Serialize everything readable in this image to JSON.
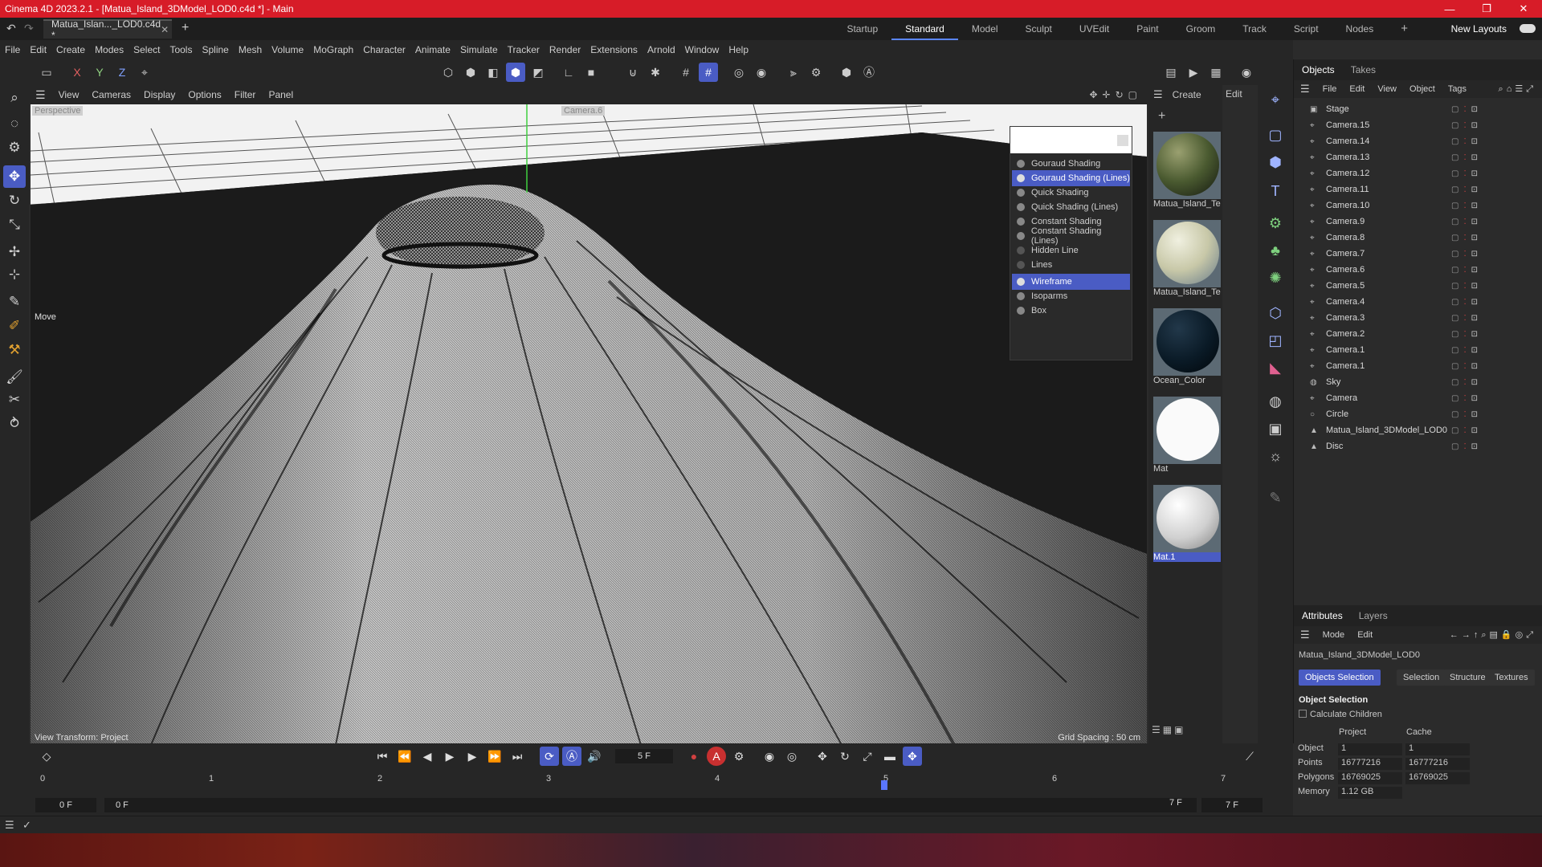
{
  "app": {
    "title": "Cinema 4D 2023.2.1 - [Matua_Island_3DModel_LOD0.c4d *] - Main",
    "document_tab": "Matua_Islan..._LOD0.c4d *",
    "accent_color": "#4a5cc4",
    "titlebar_color": "#d71c28"
  },
  "layouts": {
    "items": [
      "Startup",
      "Standard",
      "Model",
      "Sculpt",
      "UVEdit",
      "Paint",
      "Groom",
      "Track",
      "Script",
      "Nodes"
    ],
    "active": "Standard",
    "new_layouts": "New Layouts"
  },
  "menubar": [
    "File",
    "Edit",
    "Create",
    "Modes",
    "Select",
    "Tools",
    "Spline",
    "Mesh",
    "Volume",
    "MoGraph",
    "Character",
    "Animate",
    "Simulate",
    "Tracker",
    "Render",
    "Extensions",
    "Arnold",
    "Window",
    "Help"
  ],
  "viewport": {
    "menu": [
      "View",
      "Cameras",
      "Display",
      "Options",
      "Filter",
      "Panel"
    ],
    "camera_label": "Perspective",
    "camera_name": "Camera.6",
    "tool_hint": "Move",
    "transform_label": "View Transform: Project",
    "grid_spacing": "Grid Spacing : 50 cm"
  },
  "shading_menu": {
    "items": [
      {
        "label": "Gouraud Shading",
        "selected": false
      },
      {
        "label": "Gouraud Shading (Lines)",
        "selected": true
      },
      {
        "label": "Quick Shading",
        "selected": false
      },
      {
        "label": "Quick Shading (Lines)",
        "selected": false
      },
      {
        "label": "Constant Shading",
        "selected": false
      },
      {
        "label": "Constant Shading (Lines)",
        "selected": false
      },
      {
        "label": "Hidden Line",
        "selected": false
      },
      {
        "label": "Lines",
        "selected": false
      },
      {
        "label": "Wireframe",
        "selected": true
      },
      {
        "label": "Isoparms",
        "selected": false
      },
      {
        "label": "Box",
        "selected": false
      }
    ]
  },
  "materials": {
    "menu": [
      "Create",
      "Edit"
    ],
    "items": [
      "Matua_Island_Text",
      "Matua_Island_Text",
      "Ocean_Color",
      "Mat",
      "Mat.1"
    ]
  },
  "objects_panel": {
    "tabs": [
      "Objects",
      "Takes"
    ],
    "menu": [
      "File",
      "Edit",
      "View",
      "Object",
      "Tags"
    ],
    "rows": [
      "Stage",
      "Camera.15",
      "Camera.14",
      "Camera.13",
      "Camera.12",
      "Camera.11",
      "Camera.10",
      "Camera.9",
      "Camera.8",
      "Camera.7",
      "Camera.6",
      "Camera.5",
      "Camera.4",
      "Camera.3",
      "Camera.2",
      "Camera.1",
      "Camera.1",
      "Sky",
      "Camera",
      "Circle",
      "Matua_Island_3DModel_LOD0",
      "Disc"
    ]
  },
  "attributes_panel": {
    "tabs": [
      "Attributes",
      "Layers"
    ],
    "menu": [
      "Mode",
      "Edit"
    ],
    "object_name": "Matua_Island_3DModel_LOD0",
    "buttons": [
      "Objects Selection",
      "Selection",
      "Structure",
      "Textures"
    ],
    "section": "Object Selection",
    "checkbox": "Calculate Children",
    "col_project": "Project",
    "col_cache": "Cache",
    "rows": [
      {
        "label": "Object",
        "project": "1",
        "cache": "1"
      },
      {
        "label": "Points",
        "project": "16777216",
        "cache": "16777216"
      },
      {
        "label": "Polygons",
        "project": "16769025",
        "cache": "16769025"
      },
      {
        "label": "Memory",
        "project": "1.12 GB",
        "cache": ""
      }
    ]
  },
  "timeline": {
    "current_frame": "5 F",
    "ticks": [
      "0",
      "1",
      "2",
      "3",
      "4",
      "5",
      "6",
      "7"
    ],
    "start_field": "0 F",
    "range_start": "0 F",
    "range_end": "7 F",
    "end_field": "7 F",
    "playhead_frame": 5
  }
}
